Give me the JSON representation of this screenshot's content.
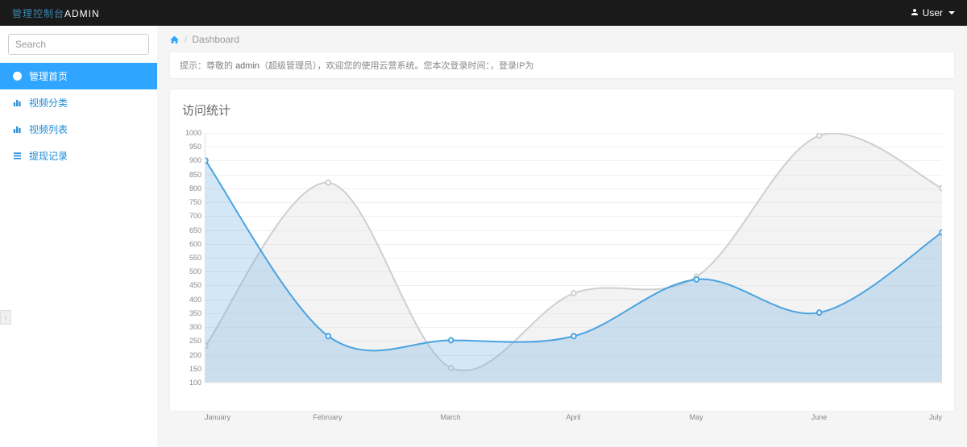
{
  "topbar": {
    "brand_zh": "管理控制台",
    "brand_en": "ADMIN",
    "user_label": "User"
  },
  "search": {
    "placeholder": "Search"
  },
  "sidebar": {
    "items": [
      {
        "label": "管理首页",
        "icon": "dashboard-icon"
      },
      {
        "label": "视频分类",
        "icon": "barchart-icon"
      },
      {
        "label": "视频列表",
        "icon": "barchart-icon"
      },
      {
        "label": "提现记录",
        "icon": "list-icon"
      }
    ]
  },
  "breadcrumb": {
    "current": "Dashboard",
    "sep": "/"
  },
  "alert": {
    "prefix": "提示：",
    "text1": "尊敬的 ",
    "bold": "admin",
    "text2": "（超级管理员），欢迎您的使用云营系统。您本次登录时间：，登录IP为"
  },
  "panel": {
    "title": "访问统计"
  },
  "chart_data": {
    "type": "line",
    "title": "访问统计",
    "xlabel": "",
    "ylabel": "",
    "ylim": [
      100,
      1000
    ],
    "categories": [
      "January",
      "February",
      "March",
      "April",
      "May",
      "June",
      "July"
    ],
    "y_ticks": [
      1000,
      950,
      900,
      850,
      800,
      750,
      700,
      650,
      600,
      550,
      500,
      450,
      400,
      350,
      300,
      250,
      200,
      150,
      100
    ],
    "series": [
      {
        "name": "series-blue",
        "color": "#4aa3e0",
        "fill": "rgba(108,176,227,0.3)",
        "values": [
          900,
          265,
          250,
          265,
          470,
          350,
          640
        ]
      },
      {
        "name": "series-gray",
        "color": "#cfcfcf",
        "fill": "rgba(220,220,220,0.35)",
        "values": [
          230,
          820,
          150,
          420,
          480,
          990,
          800
        ]
      }
    ]
  }
}
